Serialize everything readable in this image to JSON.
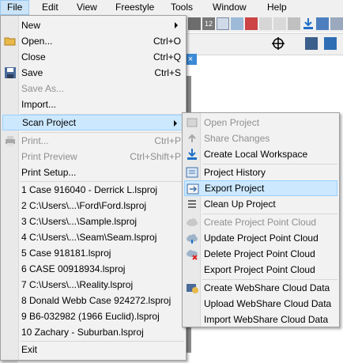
{
  "menubar": {
    "items": [
      "File",
      "Edit",
      "View",
      "Freestyle",
      "Tools",
      "Window",
      "Help"
    ]
  },
  "background": {
    "toolbar_text": "12"
  },
  "file_menu": {
    "items": [
      {
        "label": "New",
        "shortcut": "",
        "disabled": false,
        "has_submenu": true
      },
      {
        "label": "Open...",
        "shortcut": "Ctrl+O",
        "disabled": false
      },
      {
        "label": "Close",
        "shortcut": "Ctrl+Q",
        "disabled": false
      },
      {
        "label": "Save",
        "shortcut": "Ctrl+S",
        "disabled": false
      },
      {
        "label": "Save As...",
        "shortcut": "",
        "disabled": true
      },
      {
        "label": "Import...",
        "shortcut": "",
        "disabled": false
      },
      {
        "label": "Scan Project",
        "shortcut": "",
        "disabled": false,
        "has_submenu": true,
        "highlighted": true
      },
      {
        "label": "Print...",
        "shortcut": "Ctrl+P",
        "disabled": true
      },
      {
        "label": "Print Preview",
        "shortcut": "Ctrl+Shift+P",
        "disabled": true
      },
      {
        "label": "Print Setup...",
        "shortcut": "",
        "disabled": false
      },
      {
        "label": "1 Case 916040 - Derrick L.lsproj",
        "shortcut": ""
      },
      {
        "label": "2 C:\\Users\\...\\Ford\\Ford.lsproj",
        "shortcut": ""
      },
      {
        "label": "3 C:\\Users\\...\\Sample.lsproj",
        "shortcut": ""
      },
      {
        "label": "4 C:\\Users\\...\\Seam\\Seam.lsproj",
        "shortcut": ""
      },
      {
        "label": "5 Case 918181.lsproj",
        "shortcut": ""
      },
      {
        "label": "6 CASE 00918934.lsproj",
        "shortcut": ""
      },
      {
        "label": "7 C:\\Users\\...\\Reality.lsproj",
        "shortcut": ""
      },
      {
        "label": "8 Donald Webb Case 924272.lsproj",
        "shortcut": ""
      },
      {
        "label": "9 B6-032982 (1966 Euclid).lsproj",
        "shortcut": ""
      },
      {
        "label": "10 Zachary - Suburban.lsproj",
        "shortcut": ""
      },
      {
        "label": "Exit",
        "shortcut": ""
      }
    ]
  },
  "scan_project_menu": {
    "items": [
      {
        "label": "Open Project",
        "disabled": true,
        "icon": "open-project-icon"
      },
      {
        "label": "Share Changes",
        "disabled": true,
        "icon": "share-changes-icon"
      },
      {
        "label": "Create Local Workspace",
        "disabled": false,
        "icon": "download-icon"
      },
      {
        "label": "Project History",
        "disabled": false,
        "icon": "history-icon"
      },
      {
        "label": "Export Project",
        "disabled": false,
        "icon": "export-icon",
        "highlighted": true
      },
      {
        "label": "Clean Up Project",
        "disabled": false,
        "icon": "cleanup-icon"
      },
      {
        "label": "Create Project Point Cloud",
        "disabled": true,
        "icon": "cloud-icon"
      },
      {
        "label": "Update Project Point Cloud",
        "disabled": false,
        "icon": "cloud-update-icon"
      },
      {
        "label": "Delete Project Point Cloud",
        "disabled": false,
        "icon": "cloud-delete-icon"
      },
      {
        "label": "Export Project Point Cloud",
        "disabled": false,
        "icon": ""
      },
      {
        "label": "Create WebShare Cloud Data",
        "disabled": false,
        "icon": "webshare-icon"
      },
      {
        "label": "Upload WebShare Cloud Data",
        "disabled": false,
        "icon": ""
      },
      {
        "label": "Import WebShare Cloud Data",
        "disabled": false,
        "icon": ""
      }
    ]
  },
  "colors": {
    "highlight": "#cce8ff",
    "highlight_border": "#99d1ff",
    "disabled_text": "#8f8f8f",
    "menu_bg": "#f2f2f2"
  }
}
